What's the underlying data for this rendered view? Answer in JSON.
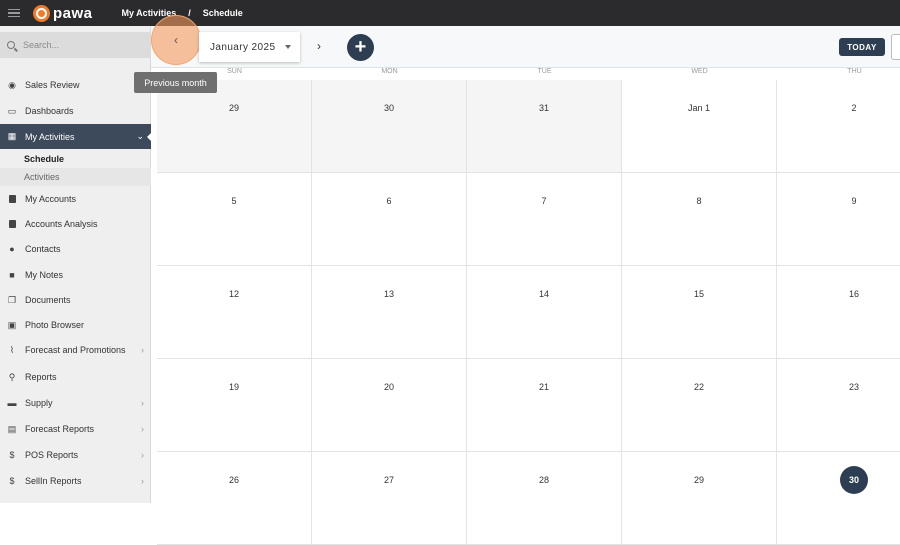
{
  "topbar": {
    "logo": "pawa",
    "breadcrumb": [
      "My Activities",
      "Schedule"
    ],
    "separator": "/"
  },
  "sidebar": {
    "search_placeholder": "Search...",
    "items": [
      {
        "label": "Sales Review",
        "icon": "gauge-icon"
      },
      {
        "label": "Dashboards",
        "icon": "monitor-icon"
      },
      {
        "label": "My Activities",
        "icon": "calendar-icon",
        "active": true
      },
      {
        "label": "My Accounts",
        "icon": "building-icon"
      },
      {
        "label": "Accounts Analysis",
        "icon": "building-icon"
      },
      {
        "label": "Contacts",
        "icon": "person-icon"
      },
      {
        "label": "My Notes",
        "icon": "note-icon"
      },
      {
        "label": "Documents",
        "icon": "documents-icon"
      },
      {
        "label": "Photo Browser",
        "icon": "image-icon"
      },
      {
        "label": "Forecast and Promotions",
        "icon": "chart-icon",
        "expandable": true
      },
      {
        "label": "Reports",
        "icon": "search-icon"
      },
      {
        "label": "Supply",
        "icon": "truck-icon",
        "expandable": true
      },
      {
        "label": "Forecast Reports",
        "icon": "table-icon",
        "expandable": true
      },
      {
        "label": "POS Reports",
        "icon": "dollar-icon",
        "expandable": true
      },
      {
        "label": "SellIn Reports",
        "icon": "dollar-icon",
        "expandable": true
      }
    ],
    "subitems": [
      "Schedule",
      "Activities"
    ]
  },
  "calendar": {
    "month_label": "January 2025",
    "today_label": "TODAY",
    "tooltip": "Previous month",
    "weekdays": [
      "SUN",
      "MON",
      "TUE",
      "WED",
      "THU"
    ],
    "weeks": [
      [
        "29",
        "30",
        "31",
        "Jan 1",
        "2"
      ],
      [
        "5",
        "6",
        "7",
        "8",
        "9"
      ],
      [
        "12",
        "13",
        "14",
        "15",
        "16"
      ],
      [
        "19",
        "20",
        "21",
        "22",
        "23"
      ],
      [
        "26",
        "27",
        "28",
        "29",
        "30"
      ]
    ],
    "today_date": "30"
  },
  "colors": {
    "accent": "#2e3e52",
    "brand": "#f07a28",
    "active_nav": "#3c4a5c"
  }
}
